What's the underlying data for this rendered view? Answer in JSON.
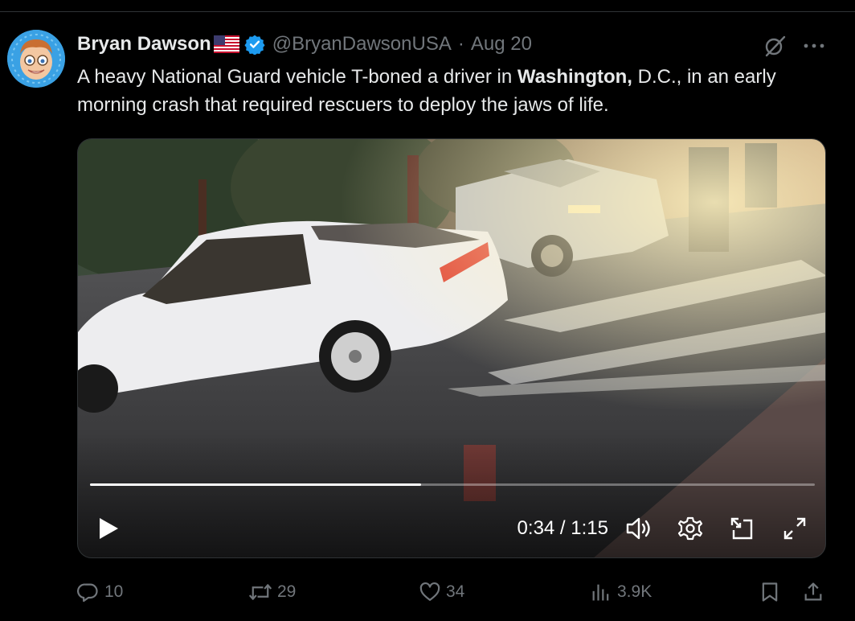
{
  "tweet": {
    "author": {
      "display_name": "Bryan Dawson",
      "flag": "us-flag-icon",
      "verified": true,
      "handle": "@BryanDawsonUSA",
      "separator": "·",
      "date": "Aug 20"
    },
    "text": {
      "part1": "A heavy National Guard vehicle T-boned a driver in ",
      "bold": "Washington,",
      "part2": " D.C., in an early morning crash that required rescuers to deploy the jaws of life."
    },
    "video": {
      "current_time": "0:34",
      "time_separator": " / ",
      "duration": "1:15",
      "progress_fraction": 0.457
    },
    "actions": {
      "replies": "10",
      "reposts": "29",
      "likes": "34",
      "views": "3.9K"
    }
  },
  "colors": {
    "background": "#000000",
    "text_primary": "#e7e9ea",
    "text_secondary": "#71767b",
    "verified_blue": "#1d9bf0",
    "divider": "#2f3336"
  },
  "icons": {
    "header": [
      "grok-icon",
      "more-icon"
    ],
    "video_controls": [
      "play-icon",
      "volume-icon",
      "settings-icon",
      "pip-icon",
      "fullscreen-icon"
    ],
    "actions": [
      "reply-icon",
      "repost-icon",
      "like-icon",
      "views-icon",
      "bookmark-icon",
      "share-icon"
    ]
  }
}
